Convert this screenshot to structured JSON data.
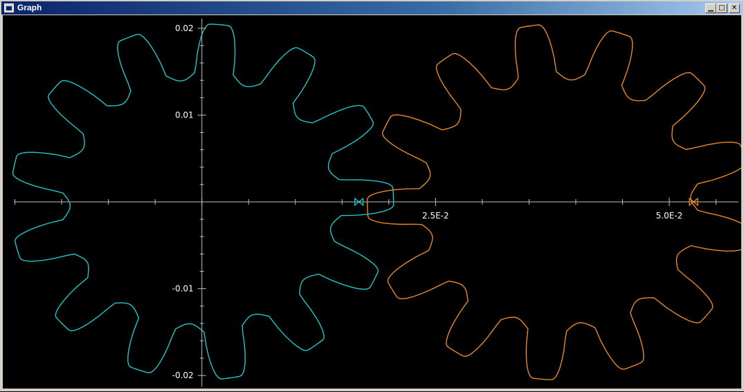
{
  "window": {
    "title": "Graph",
    "icons": {
      "app": "graph-window-icon",
      "minimize": "minimize-icon",
      "maximize": "maximize-icon",
      "close": "close-icon"
    }
  },
  "chart_data": {
    "type": "line",
    "title": "",
    "xlabel": "",
    "ylabel": "",
    "x_tick_labels": [
      "2.5E-2",
      "5.0E-2"
    ],
    "y_tick_labels": [
      "0.02",
      "0.01",
      "-0.01",
      "-0.02"
    ],
    "x_ticks": [
      0.025,
      0.05
    ],
    "y_ticks": [
      0.02,
      0.01,
      -0.01,
      -0.02
    ],
    "xlim": [
      -0.0213,
      0.0577
    ],
    "ylim": [
      -0.0215,
      0.0215
    ],
    "grid": false,
    "series": [
      {
        "color": "#20c8c8",
        "shape": "gear",
        "center": [
          0.0,
          0.0
        ],
        "teeth": 13,
        "outer_radius": 0.0205,
        "root_radius": 0.015,
        "phase_deg": -6
      },
      {
        "color": "#e88a2a",
        "shape": "gear",
        "center": [
          0.0382,
          0.0
        ],
        "teeth": 13,
        "outer_radius": 0.0205,
        "root_radius": 0.015,
        "phase_deg": 8
      }
    ],
    "markers": [
      {
        "color": "#20c8c8",
        "x": 0.0168,
        "y": 0.0
      },
      {
        "color": "#e88a2a",
        "x": 0.0526,
        "y": 0.0
      }
    ]
  }
}
